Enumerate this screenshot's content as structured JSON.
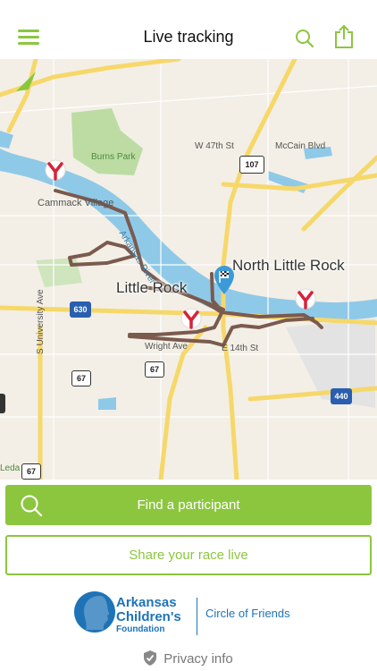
{
  "header": {
    "title": "Live tracking"
  },
  "map": {
    "labels": {
      "w47th": "W 47th St",
      "mccain": "McCain Blvd",
      "burns_park": "Burns Park",
      "cammack": "Cammack Village",
      "arkansas_river": "Arkansas River",
      "north_little_rock": "North Little Rock",
      "little_rock": "Little Rock",
      "wright_ave": "Wright Ave",
      "e_14th": "E 14th St",
      "s_university": "S University Ave",
      "leda": "Leda"
    },
    "shields": {
      "i630": "630",
      "i440": "440",
      "us67a": "67",
      "us67b": "67",
      "us67c": "67",
      "r107": "107"
    },
    "colors": {
      "route": "#7b5a4e",
      "water": "#8fc9e8",
      "park": "#bcdca4",
      "highway": "#f6d86a",
      "land": "#f3efe6"
    }
  },
  "actions": {
    "find_participant": "Find a participant",
    "share_race": "Share your race live"
  },
  "sponsor": {
    "line1": "Arkansas",
    "line2": "Children's",
    "line3": "Foundation",
    "tagline": "Circle of Friends"
  },
  "footer": {
    "privacy": "Privacy info"
  },
  "colors": {
    "accent": "#8cc63f",
    "sponsor_blue": "#1e73b7"
  }
}
